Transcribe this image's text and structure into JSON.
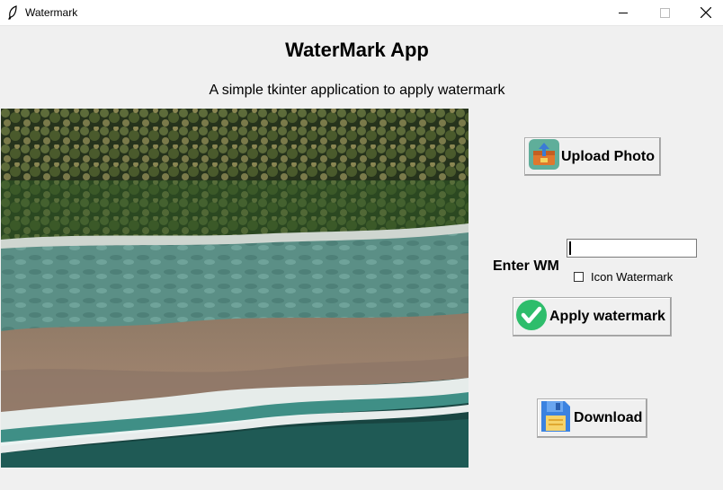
{
  "window": {
    "title": "Watermark",
    "icon": "feather-icon",
    "controls": [
      "minimize-icon",
      "maximize-icon",
      "close-icon"
    ]
  },
  "header": {
    "title": "WaterMark App",
    "subtitle": "A simple tkinter application to apply watermark"
  },
  "preview": {
    "description_icon": "aerial-beach-photo"
  },
  "buttons": {
    "upload": {
      "label": "Upload Photo",
      "icon": "upload-box-icon"
    },
    "apply": {
      "label": "Apply watermark",
      "icon": "green-checkmark-icon"
    },
    "download": {
      "label": "Download",
      "icon": "floppy-disk-icon"
    }
  },
  "watermark": {
    "label": "Enter WM",
    "value": "",
    "icon_checkbox_label": "Icon Watermark",
    "icon_checkbox_checked": false
  },
  "colors": {
    "background": "#f0f0f0",
    "check_green": "#2ebd6b",
    "floppy_blue": "#3b82e0"
  }
}
